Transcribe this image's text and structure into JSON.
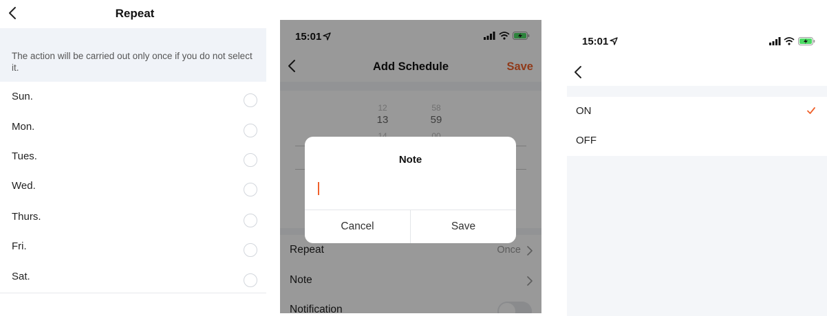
{
  "repeat_screen": {
    "title": "Repeat",
    "notice": "The action will be carried out only once if you do not select it.",
    "days": [
      "Sun.",
      "Mon.",
      "Tues.",
      "Wed.",
      "Thurs.",
      "Fri.",
      "Sat."
    ]
  },
  "schedule_screen": {
    "status_time": "15:01",
    "title": "Add Schedule",
    "save_label": "Save",
    "picker": {
      "hours": [
        "12",
        "13",
        "14"
      ],
      "minutes": [
        "58",
        "59",
        "00"
      ]
    },
    "rows": {
      "repeat": {
        "label": "Repeat",
        "value": "Once"
      },
      "note": {
        "label": "Note"
      },
      "notification": {
        "label": "Notification",
        "enabled": false
      }
    },
    "dialog": {
      "title": "Note",
      "input_value": "",
      "cancel_label": "Cancel",
      "save_label": "Save"
    }
  },
  "switch_screen": {
    "status_time": "15:01",
    "options": [
      {
        "label": "ON",
        "selected": true
      },
      {
        "label": "OFF",
        "selected": false
      }
    ]
  },
  "colors": {
    "accent": "#f0612b",
    "battery_green": "#4cd964",
    "background_light": "#f4f6f9"
  },
  "icons": [
    "back-chevron-icon",
    "radio-icon",
    "location-arrow-icon",
    "signal-icon",
    "wifi-icon",
    "battery-charging-icon",
    "chevron-right-icon",
    "checkmark-icon"
  ]
}
